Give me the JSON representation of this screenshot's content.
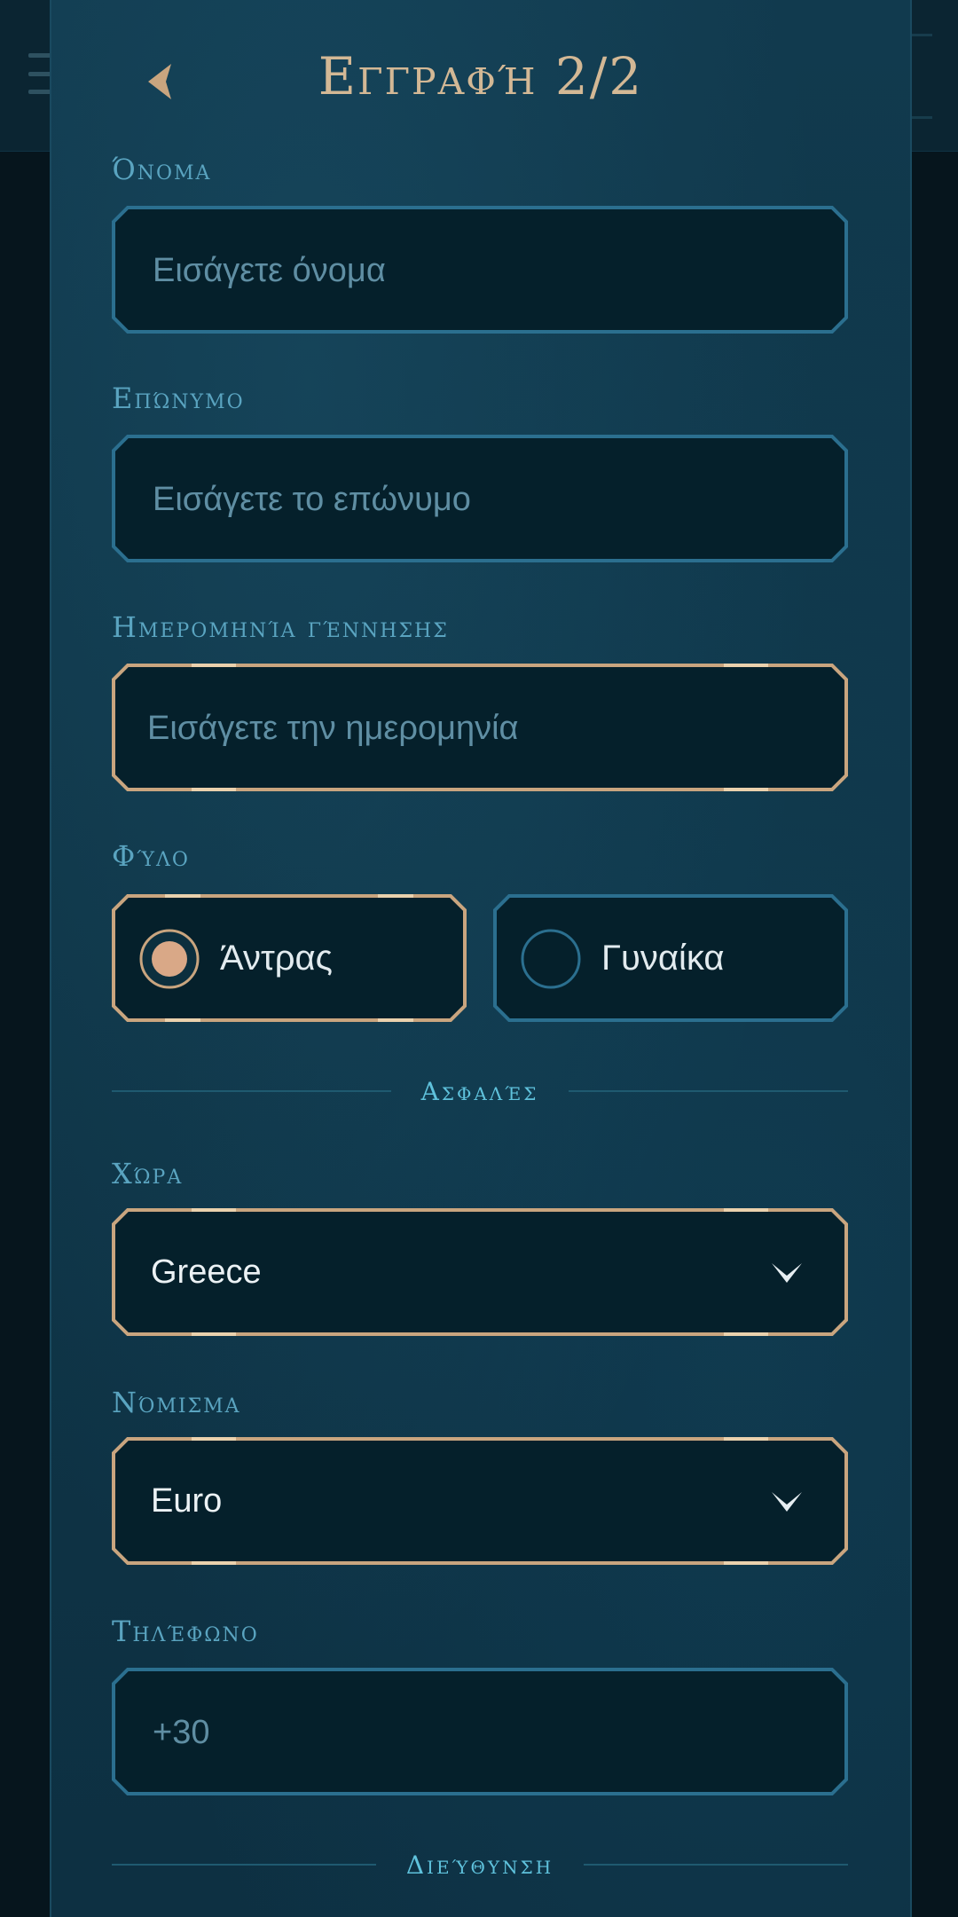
{
  "header": {
    "title": "Εγγραφή 2/2"
  },
  "first_name": {
    "label": "Όνομα",
    "placeholder": "Εισάγετε όνομα"
  },
  "last_name": {
    "label": "Επώνυμο",
    "placeholder": "Εισάγετε το επώνυμο"
  },
  "birth_date": {
    "label": "Ημερομηνία γέννησης",
    "placeholder": "Εισάγετε την ημερομηνία"
  },
  "gender": {
    "label": "Φύλο",
    "options": [
      {
        "label": "Άντρας",
        "selected": true
      },
      {
        "label": "Γυναίκα",
        "selected": false
      }
    ]
  },
  "section_secure": "Ασφαλές",
  "country": {
    "label": "Χώρα",
    "value": "Greece"
  },
  "currency": {
    "label": "Νόμισμα",
    "value": "Euro"
  },
  "phone": {
    "label": "Τηλέφωνο",
    "placeholder": "+30"
  },
  "section_address": "Διεύθυνση",
  "colors": {
    "gold": "#c9a57f",
    "blue_border": "#2b6f8f",
    "field_fill": "#05202b",
    "accent_text": "#5fc2dc"
  },
  "icons": {
    "back": "chevron-left-icon",
    "dropdown": "chevron-down-icon"
  }
}
